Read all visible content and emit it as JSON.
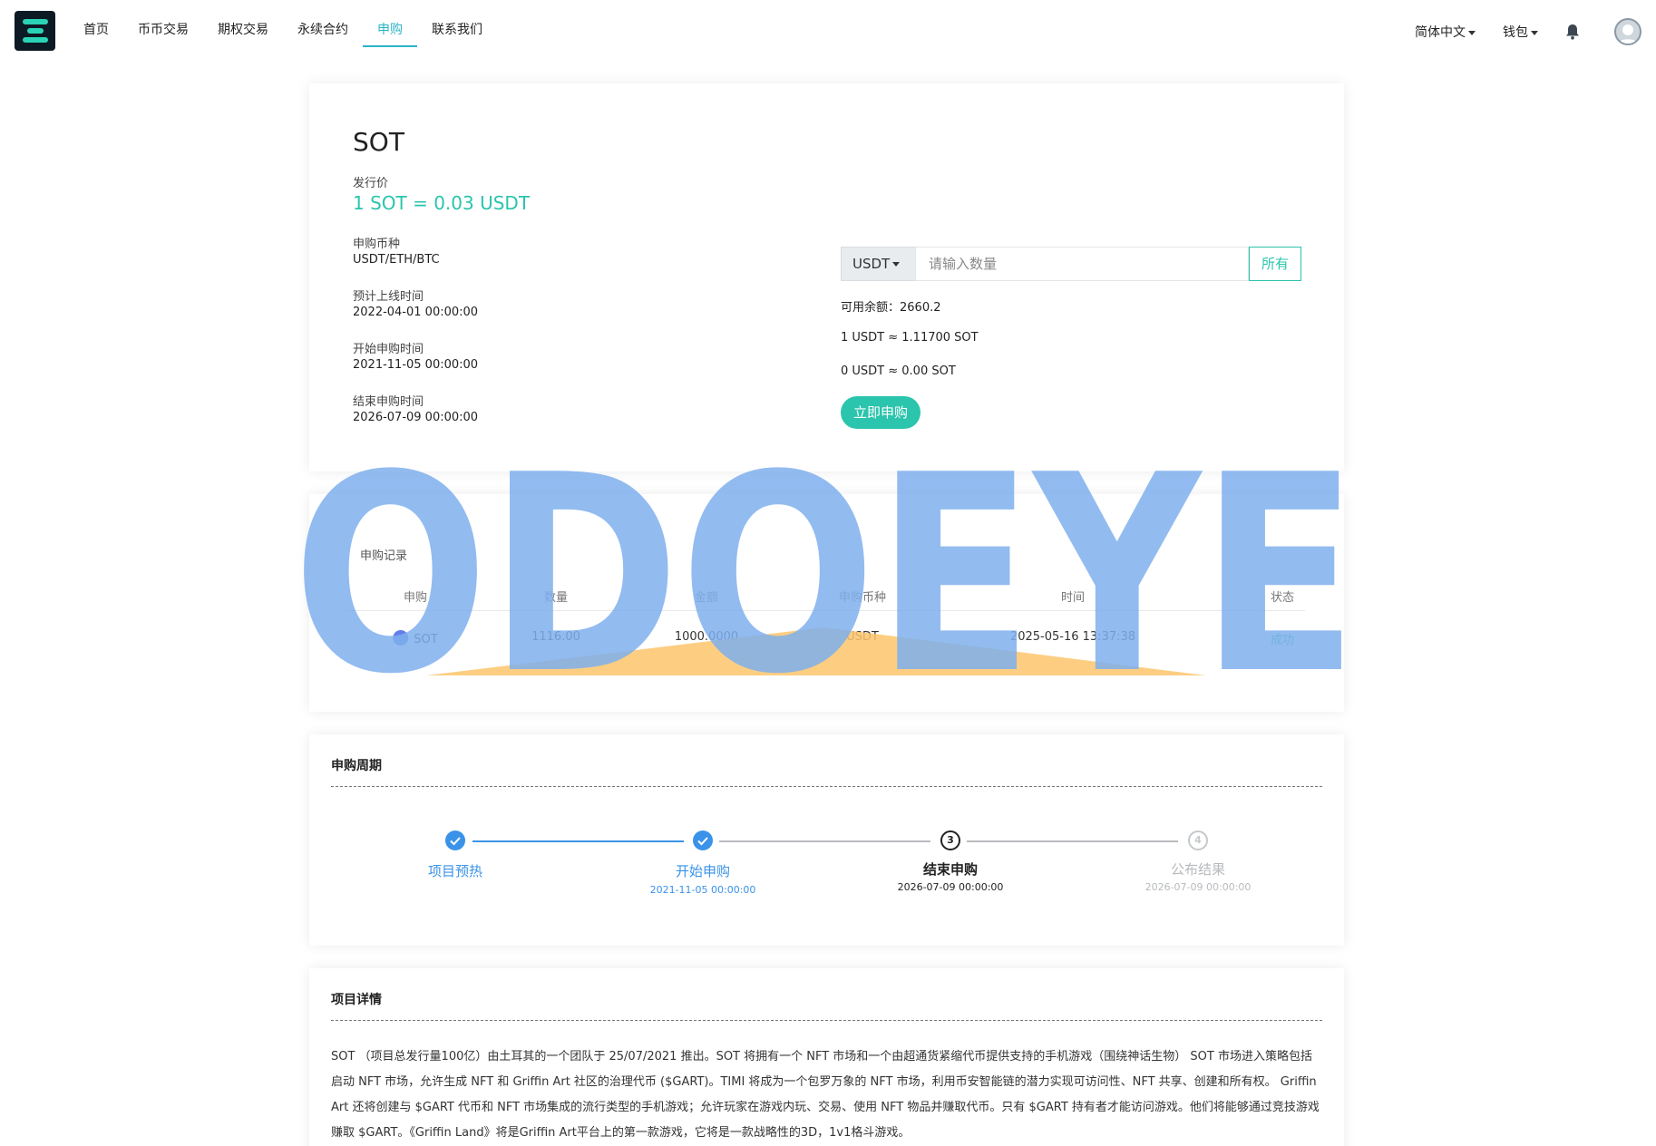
{
  "nav": {
    "items": [
      "首页",
      "币币交易",
      "期权交易",
      "永续合约",
      "申购",
      "联系我们"
    ],
    "active_index": 4,
    "language": "简体中文",
    "wallet": "钱包"
  },
  "ido": {
    "coin": "SOT",
    "price_label": "发行价",
    "price_value": "1 SOT = 0.03 USDT",
    "currency_label": "申购币种",
    "currency_value": "USDT/ETH/BTC",
    "listing_label": "预计上线时间",
    "listing_value": "2022-04-01 00:00:00",
    "start_label": "开始申购时间",
    "start_value": "2021-11-05 00:00:00",
    "end_label": "结束申购时间",
    "end_value": "2026-07-09 00:00:00"
  },
  "buy": {
    "selected_currency": "USDT",
    "placeholder": "请输入数量",
    "all_label": "所有",
    "balance": "可用余额：2660.2",
    "rate": "1 USDT ≈ 1.11700 SOT",
    "estimate": "0 USDT ≈ 0.00 SOT",
    "submit_label": "立即申购"
  },
  "records": {
    "title": "申购记录",
    "columns": [
      "申购",
      "数量",
      "金额",
      "申购币种",
      "时间",
      "状态"
    ],
    "rows": [
      {
        "coin": "SOT",
        "amount": "1116.00",
        "total": "1000.0000",
        "currency": "USDT",
        "time": "2025-05-16 13:37:38",
        "status": "成功"
      }
    ]
  },
  "period": {
    "title": "申购周期",
    "steps": [
      {
        "name": "项目预热",
        "time": "",
        "state": "done"
      },
      {
        "name": "开始申购",
        "time": "2021-11-05 00:00:00",
        "state": "done"
      },
      {
        "name": "结束申购",
        "time": "2026-07-09 00:00:00",
        "state": "current",
        "number": "3"
      },
      {
        "name": "公布结果",
        "time": "2026-07-09 00:00:00",
        "state": "todo",
        "number": "4"
      }
    ]
  },
  "detail": {
    "title": "项目详情",
    "text": "SOT （项目总发行量100亿）由土耳其的一个团队于 25/07/2021 推出。SOT 将拥有一个 NFT 市场和一个由超通货紧缩代币提供支持的手机游戏（围绕神话生物） SOT 市场进入策略包括启动 NFT 市场，允许生成 NFT 和 Griffin Art 社区的治理代币 ($GART)。TIMI 将成为一个包罗万象的 NFT 市场，利用币安智能链的潜力实现可访问性、NFT 共享、创建和所有权。 Griffin Art 还将创建与 $GART 代币和 NFT 市场集成的流行类型的手机游戏；允许玩家在游戏内玩、交易、使用 NFT 物品并赚取代币。只有 $GART 持有者才能访问游戏。他们将能够通过竞技游戏赚取 $GART。《Griffin Land》将是Griffin Art平台上的第一款游戏，它将是一款战略性的3D，1v1格斗游戏。"
  },
  "watermark": {
    "text": "ODOEYE"
  },
  "colors": {
    "accent": "#2bc4ad",
    "nav_active": "#2bb3c8",
    "step_done": "#3a93e8",
    "watermark_blue": "#7fb0ee",
    "watermark_orange": "#fdc56b"
  }
}
